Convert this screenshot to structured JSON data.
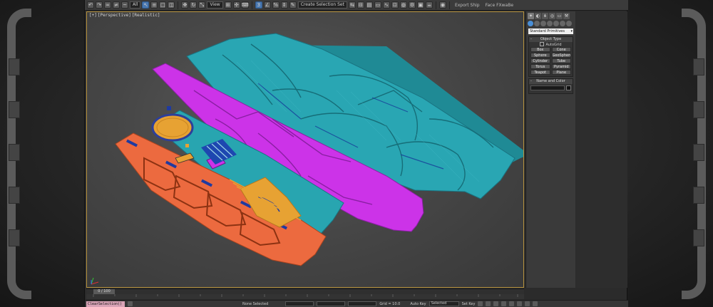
{
  "toolbar": {
    "selection_filter": "All",
    "named_selection_dropdown": "View",
    "named_selection_set_dropdown": "Create Selection Set",
    "export_ship_label": "Export Ship",
    "face_fx_label": "Face FXwaBe"
  },
  "viewport": {
    "label_plus": "[+]",
    "label_view": "[Perspective]",
    "label_shading": "[Realistic]"
  },
  "command_panel": {
    "primitive_type": "Standard Primitives",
    "object_type_header": "Object Type",
    "autogrid_label": "AutoGrid",
    "buttons": [
      "Box",
      "Cone",
      "Sphere",
      "GeoSphere",
      "Cylinder",
      "Tube",
      "Torus",
      "Pyramid",
      "Teapot",
      "Plane"
    ],
    "name_color_header": "Name and Color"
  },
  "timeline": {
    "frame_counter": "0 / 100"
  },
  "status": {
    "maxscript": "ClearSelection()",
    "selection_text": "None Selected",
    "grid_text": "Grid = 10.0",
    "autokey_label": "Auto Key",
    "selected_dropdown": "Selected",
    "set_key_label": "Set Key"
  },
  "colors": {
    "teal": "#29a6b3",
    "magenta": "#cc33e8",
    "orange": "#ec6a3f",
    "yellow_orange": "#e7a233",
    "viewport_border": "#b8943f",
    "maxscript_bg": "#d9a3b6"
  }
}
